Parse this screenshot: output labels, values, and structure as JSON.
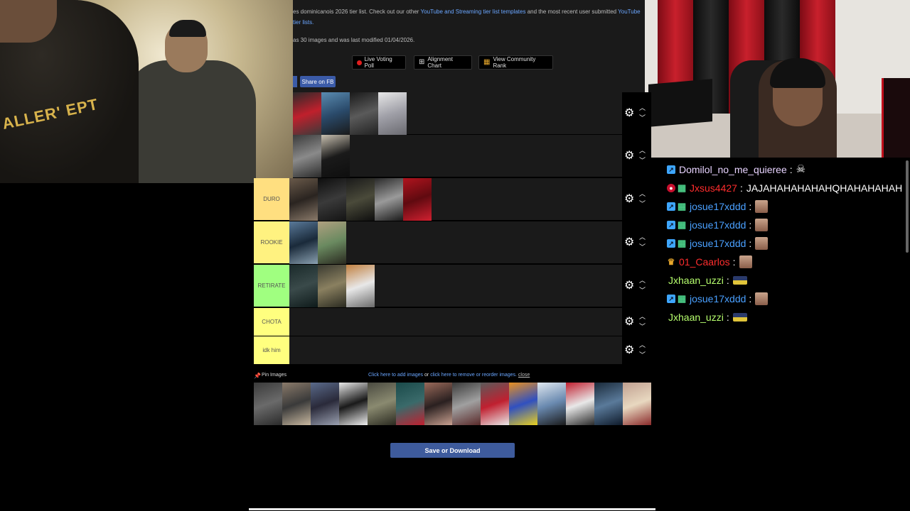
{
  "page": {
    "intro_before": "es dominicanois 2026 tier list. Check out our other",
    "intro_link1": "YouTube and Streaming tier list templates",
    "intro_mid": "and the most recent user submitted",
    "intro_link2": "YouTube",
    "intro_link3": "tier lists.",
    "meta": "as 30 images and was last modified 01/04/2026.",
    "buttons": {
      "live_voting": "Live Voting Poll",
      "alignment": "Alignment Chart",
      "community": "View Community Rank"
    },
    "share_fb": "Share on FB",
    "tiers": [
      {
        "label": "",
        "images": 4
      },
      {
        "label": "",
        "images": 2
      },
      {
        "label": "DURO",
        "images": 5
      },
      {
        "label": "ROOKIE",
        "images": 2
      },
      {
        "label": "RETIRATE",
        "images": 3
      },
      {
        "label": "CHOTA",
        "images": 0
      },
      {
        "label": "idk him",
        "images": 0
      }
    ],
    "pin_images": "Pin Images",
    "add_images": "Click here to add images",
    "or_text": "or",
    "remove_images": "click here to remove or reorder images.",
    "close": "close",
    "save_download": "Save or Download"
  },
  "chat": [
    {
      "user": "Domilol_no_me_quieree",
      "color": "#e8d3ff",
      "badges": [
        "prime"
      ],
      "emote": "skull",
      "msg": ""
    },
    {
      "user": "Jxsus4427",
      "color": "#ff2d2d",
      "badges": [
        "red",
        "sub"
      ],
      "emote": "",
      "msg": "JAJAHAHAHAHAHQHAHAHAHAH"
    },
    {
      "user": "josue17xddd",
      "color": "#4aa0ff",
      "badges": [
        "prime",
        "sub"
      ],
      "emote": "face",
      "msg": ""
    },
    {
      "user": "josue17xddd",
      "color": "#4aa0ff",
      "badges": [
        "prime",
        "sub"
      ],
      "emote": "face",
      "msg": ""
    },
    {
      "user": "josue17xddd",
      "color": "#4aa0ff",
      "badges": [
        "prime",
        "sub"
      ],
      "emote": "face",
      "msg": ""
    },
    {
      "user": "01_Caarlos",
      "color": "#ff2d2d",
      "badges": [
        "crown"
      ],
      "emote": "face",
      "msg": ""
    },
    {
      "user": "Jxhaan_uzzi",
      "color": "#b7ff6e",
      "badges": [],
      "emote": "car",
      "msg": ""
    },
    {
      "user": "josue17xddd",
      "color": "#4aa0ff",
      "badges": [
        "prime",
        "sub"
      ],
      "emote": "face",
      "msg": ""
    },
    {
      "user": "Jxhaan_uzzi",
      "color": "#b7ff6e",
      "badges": [],
      "emote": "car",
      "msg": ""
    }
  ],
  "webcam_left_text": "ALLER' EPT"
}
